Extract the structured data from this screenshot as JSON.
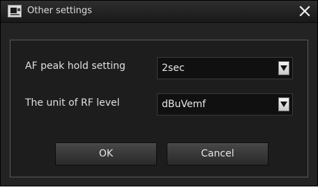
{
  "window": {
    "title": "Other settings",
    "close_icon": "close-icon",
    "app_icon": "camera-app-icon"
  },
  "settings": [
    {
      "label": "AF peak hold setting",
      "value": "2sec"
    },
    {
      "label": "The unit of RF level",
      "value": "dBuVemf"
    }
  ],
  "buttons": {
    "ok_label": "OK",
    "cancel_label": "Cancel"
  },
  "colors": {
    "background": "#232323",
    "text": "#e0e0e0",
    "dropdown_arrow_bg": "#e8e8e8"
  }
}
